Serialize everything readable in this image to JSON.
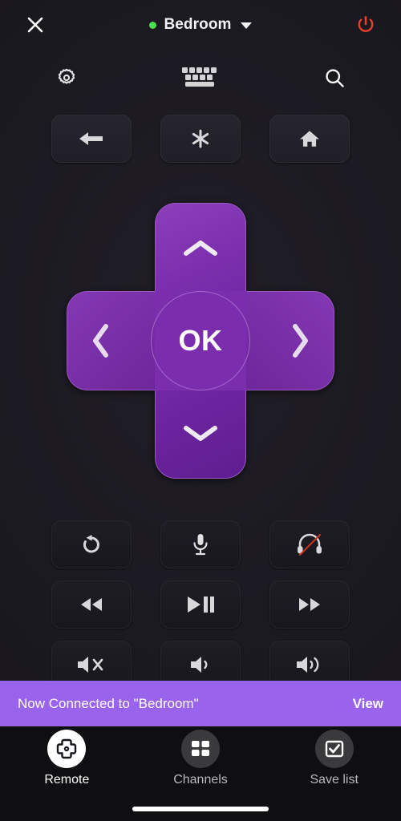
{
  "header": {
    "close_icon": "close-icon",
    "status_dot_color": "#4ade50",
    "device_name": "Bedroom",
    "caret_icon": "chevron-down-icon",
    "power_icon": "power-icon",
    "power_color": "#e8402a"
  },
  "utility_row": [
    {
      "name": "settings",
      "icon": "gear-icon"
    },
    {
      "name": "keyboard",
      "icon": "keyboard-icon"
    },
    {
      "name": "search",
      "icon": "search-icon"
    }
  ],
  "nav_row": [
    {
      "name": "back",
      "icon": "arrow-left-icon"
    },
    {
      "name": "options",
      "icon": "asterisk-icon"
    },
    {
      "name": "home",
      "icon": "home-icon"
    }
  ],
  "dpad": {
    "up_icon": "chevron-up-icon",
    "down_icon": "chevron-down-icon",
    "left_icon": "chevron-left-icon",
    "right_icon": "chevron-right-icon",
    "ok_label": "OK",
    "color": "#7a2dac",
    "color_light": "#8d3fba"
  },
  "media_rows": [
    [
      {
        "name": "replay",
        "icon": "replay-icon"
      },
      {
        "name": "voice",
        "icon": "microphone-icon"
      },
      {
        "name": "private-listening",
        "icon": "headphones-off-icon"
      }
    ],
    [
      {
        "name": "rewind",
        "icon": "rewind-icon"
      },
      {
        "name": "play-pause",
        "icon": "play-pause-icon"
      },
      {
        "name": "fast-forward",
        "icon": "fast-forward-icon"
      }
    ],
    [
      {
        "name": "mute",
        "icon": "volume-mute-icon"
      },
      {
        "name": "volume-down",
        "icon": "volume-down-icon"
      },
      {
        "name": "volume-up",
        "icon": "volume-up-icon"
      }
    ]
  ],
  "banner": {
    "message": "Now Connected to \"Bedroom\"",
    "action_label": "View",
    "background": "#9a63eb"
  },
  "tabbar": {
    "tabs": [
      {
        "label": "Remote",
        "icon": "dpad-icon",
        "active": true
      },
      {
        "label": "Channels",
        "icon": "grid-icon",
        "active": false
      },
      {
        "label": "Save list",
        "icon": "checkbox-icon",
        "active": false
      }
    ]
  }
}
